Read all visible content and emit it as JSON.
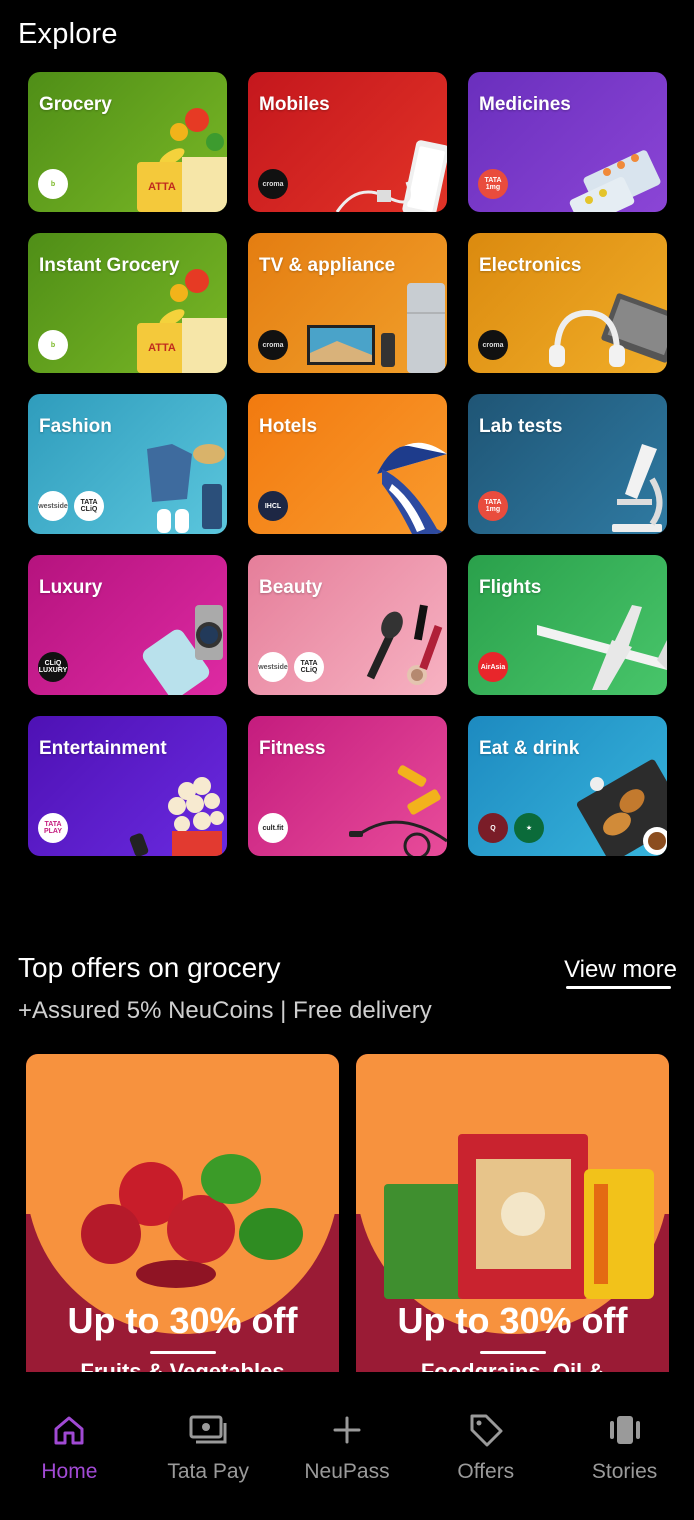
{
  "explore": {
    "title": "Explore"
  },
  "tiles": [
    {
      "label": "Grocery",
      "bg": "linear-gradient(135deg,#4f8e17,#7ab826)",
      "logos": [
        "bigbasket"
      ]
    },
    {
      "label": "Mobiles",
      "bg": "linear-gradient(135deg,#c4171d,#e23327)",
      "logos": [
        "croma"
      ]
    },
    {
      "label": "Medicines",
      "bg": "linear-gradient(135deg,#6a2fbd,#8b45d6)",
      "logos": [
        "tata 1mg"
      ]
    },
    {
      "label": "Instant Grocery",
      "bg": "linear-gradient(135deg,#4f8e17,#7ab826)",
      "logos": [
        "bigbasket"
      ]
    },
    {
      "label": "TV & appliance",
      "bg": "linear-gradient(135deg,#e47d11,#f1a02b)",
      "logos": [
        "croma"
      ]
    },
    {
      "label": "Electronics",
      "bg": "linear-gradient(135deg,#db8a0f,#f0ad28)",
      "logos": [
        "croma"
      ]
    },
    {
      "label": "Fashion",
      "bg": "linear-gradient(135deg,#2f9cbc,#5bc6dd)",
      "logos": [
        "westside",
        "tata cliq"
      ]
    },
    {
      "label": "Hotels",
      "bg": "linear-gradient(135deg,#f27a0f,#f99a2d)",
      "logos": [
        "IHCL"
      ]
    },
    {
      "label": "Lab tests",
      "bg": "linear-gradient(135deg,#1f5575,#2f7aa2)",
      "logos": [
        "tata 1mg"
      ]
    },
    {
      "label": "Luxury",
      "bg": "linear-gradient(135deg,#b5137e,#de2aa3)",
      "logos": [
        "tata cliq luxury"
      ]
    },
    {
      "label": "Beauty",
      "bg": "linear-gradient(135deg,#e57e9a,#f7b2c2)",
      "logos": [
        "westside",
        "tata cliq"
      ]
    },
    {
      "label": "Flights",
      "bg": "linear-gradient(135deg,#2aa04b,#48c56a)",
      "logos": [
        "AirAsia"
      ]
    },
    {
      "label": "Entertainment",
      "bg": "linear-gradient(135deg,#4e11b4,#6a2ae0)",
      "logos": [
        "tata play"
      ]
    },
    {
      "label": "Fitness",
      "bg": "linear-gradient(135deg,#c41c7e,#e84c9a)",
      "logos": [
        "cult.fit"
      ]
    },
    {
      "label": "Eat & drink",
      "bg": "linear-gradient(135deg,#1d8ac0,#37b4dc)",
      "logos": [
        "qmin",
        "starbucks"
      ]
    }
  ],
  "offers": {
    "title": "Top offers on grocery",
    "view_more": "View more",
    "subtitle": "+Assured 5% NeuCoins | Free delivery",
    "cards": [
      {
        "title": "Up to 30% off",
        "subtitle": "Fruits & Vegetables"
      },
      {
        "title": "Up to 30% off",
        "subtitle": "Foodgrains, Oil &"
      }
    ]
  },
  "nav": [
    {
      "label": "Home",
      "icon": "home-icon",
      "active": true
    },
    {
      "label": "Tata Pay",
      "icon": "tata-pay-icon",
      "active": false
    },
    {
      "label": "NeuPass",
      "icon": "plus-icon",
      "active": false
    },
    {
      "label": "Offers",
      "icon": "tag-icon",
      "active": false
    },
    {
      "label": "Stories",
      "icon": "stories-icon",
      "active": false
    }
  ],
  "colors": {
    "accent": "#a14ad4",
    "nav_inactive": "#9a9a9a",
    "offer_orange": "#f7923e",
    "offer_maroon": "#9a1b35"
  }
}
